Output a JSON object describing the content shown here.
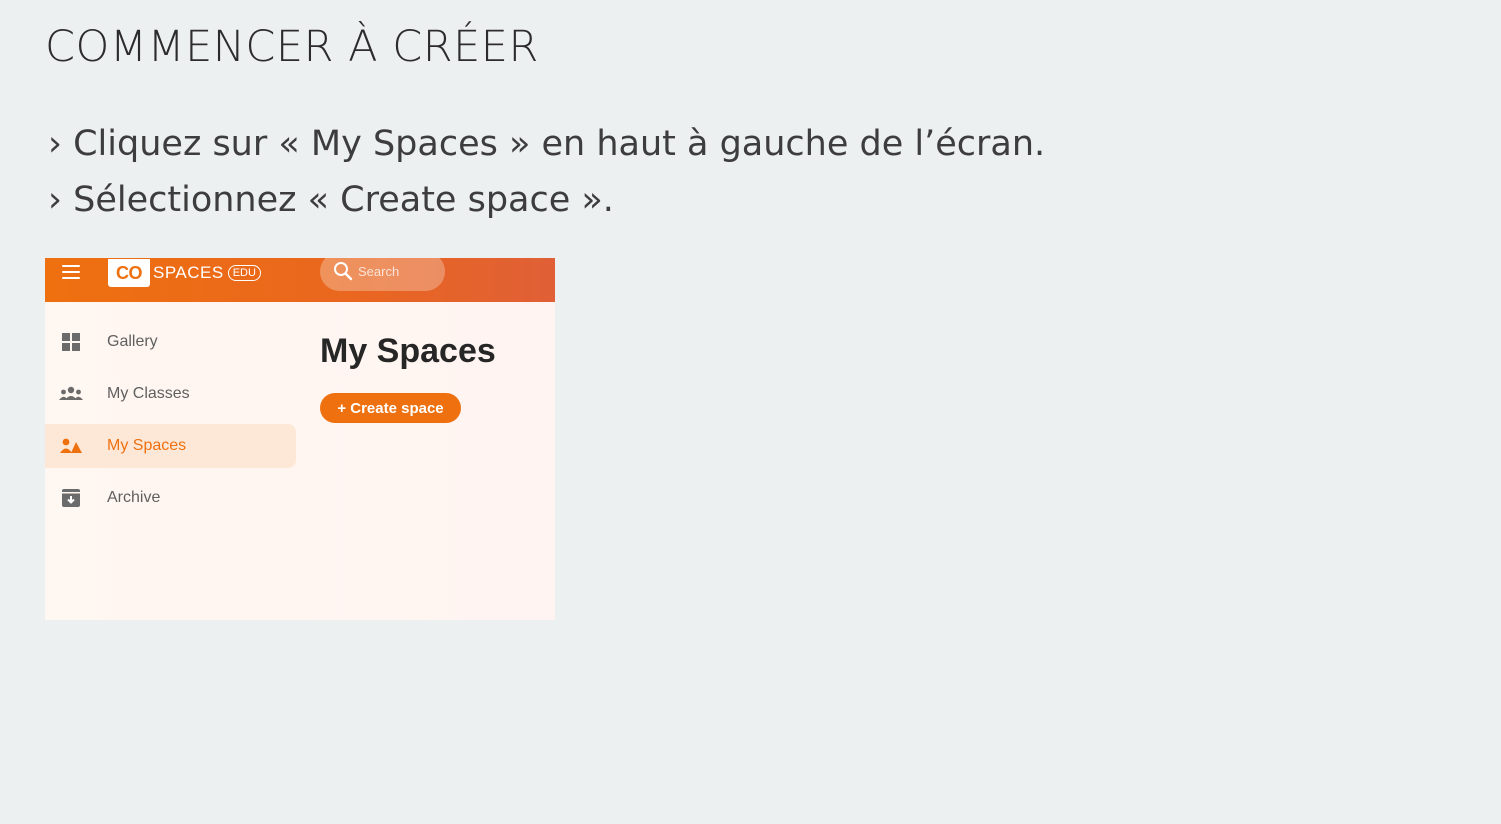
{
  "slide": {
    "title": "COMMENCER À CRÉER",
    "instructions": [
      "› Cliquez sur « My Spaces » en haut à gauche de l’écran.",
      "› Sélectionnez « Create space »."
    ]
  },
  "app": {
    "logo": {
      "co": "CO",
      "spaces": "SPACES",
      "edu": "EDU"
    },
    "search": {
      "placeholder": "Search"
    },
    "sidebar": {
      "items": [
        {
          "label": "Gallery",
          "icon": "grid-icon",
          "active": false
        },
        {
          "label": "My Classes",
          "icon": "group-icon",
          "active": false
        },
        {
          "label": "My Spaces",
          "icon": "spaces-icon",
          "active": true
        },
        {
          "label": "Archive",
          "icon": "archive-icon",
          "active": false
        }
      ]
    },
    "main": {
      "title": "My Spaces",
      "create_button": "+ Create space"
    },
    "colors": {
      "accent": "#ef700f",
      "active_bg": "#fde8d8",
      "topbar_end": "#e05f36"
    }
  }
}
